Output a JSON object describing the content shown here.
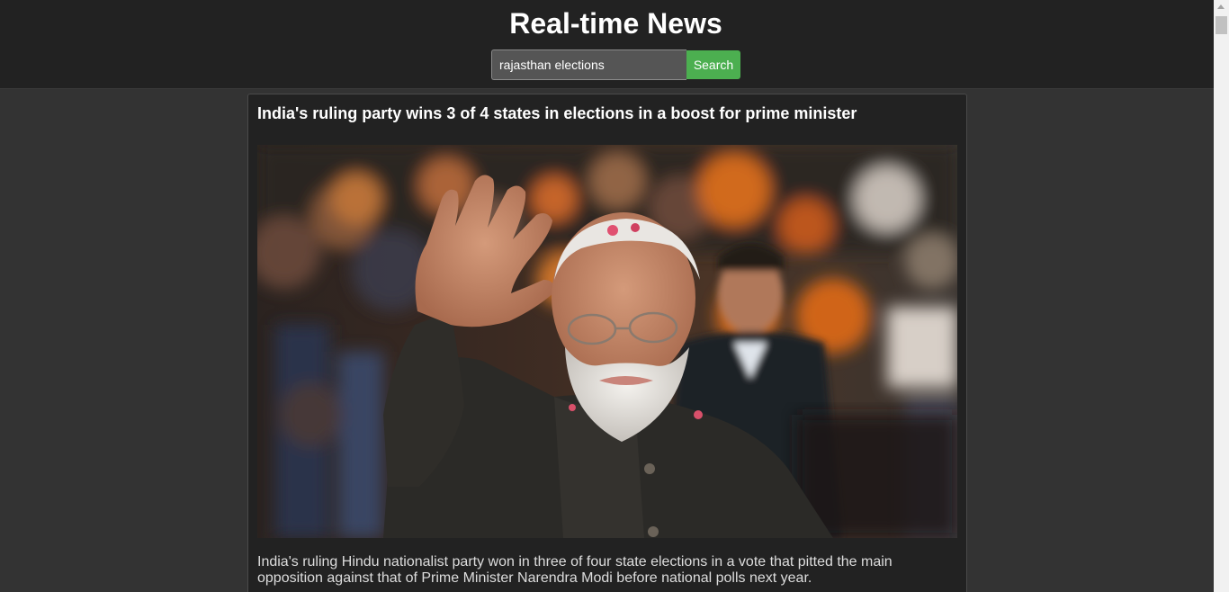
{
  "header": {
    "title": "Real-time News"
  },
  "search": {
    "value": "rajasthan elections",
    "button_label": "Search"
  },
  "articles": [
    {
      "title": "India's ruling party wins 3 of 4 states in elections in a boost for prime minister",
      "image_alt": "Narendra Modi waving to a crowd",
      "description": "India's ruling Hindu nationalist party won in three of four state elections in a vote that pitted the main opposition against that of Prime Minister Narendra Modi before national polls next year."
    }
  ],
  "colors": {
    "page_background": "#333333",
    "header_background": "#222222",
    "card_background": "#222222",
    "search_button": "#4caf50",
    "title_text": "#ffffff"
  }
}
